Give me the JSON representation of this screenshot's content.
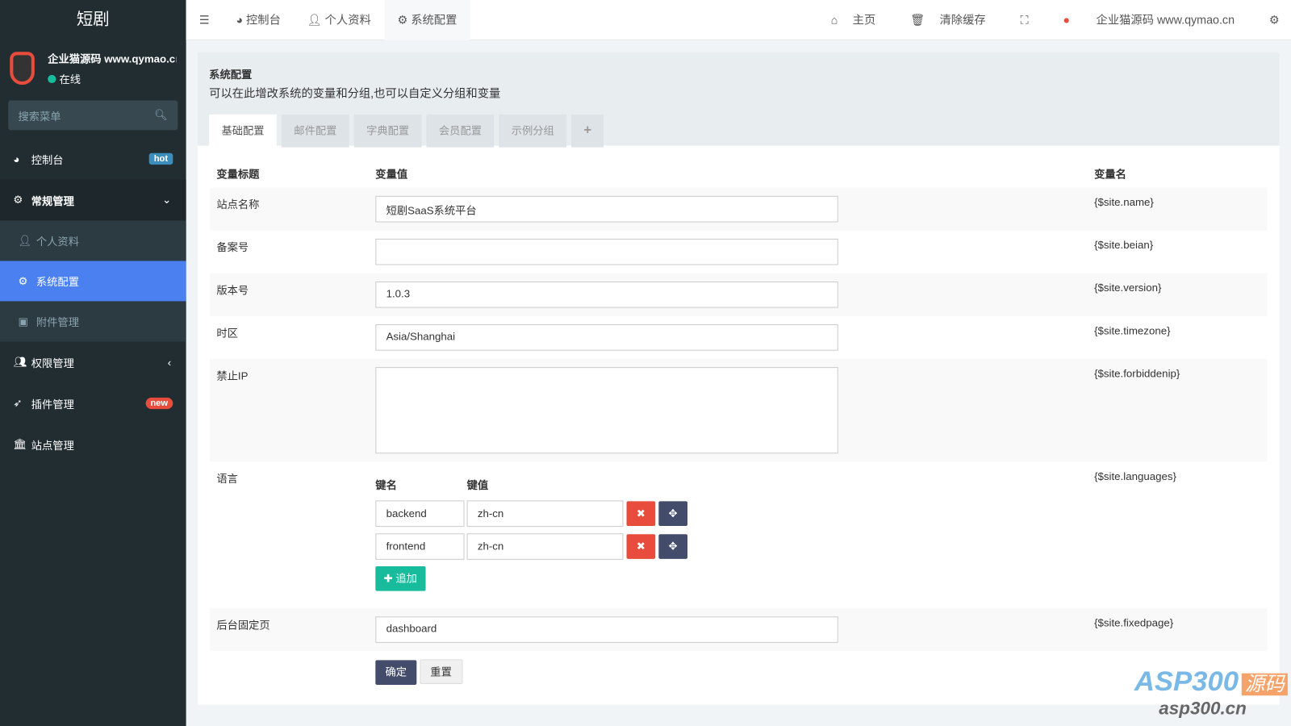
{
  "sidebar": {
    "logo": "短剧",
    "user_name": "企业猫源码 www.qymao.cn",
    "status": "在线",
    "search_placeholder": "搜索菜单",
    "items": [
      {
        "label": "控制台",
        "badge": "hot"
      },
      {
        "label": "常规管理"
      },
      {
        "label": "个人资料"
      },
      {
        "label": "系统配置"
      },
      {
        "label": "附件管理"
      },
      {
        "label": "权限管理"
      },
      {
        "label": "插件管理",
        "badge": "new"
      },
      {
        "label": "站点管理"
      }
    ]
  },
  "topbar": {
    "tabs": [
      "控制台",
      "个人资料",
      "系统配置"
    ],
    "home": "主页",
    "clear_cache": "清除缓存",
    "user": "企业猫源码 www.qymao.cn"
  },
  "panel": {
    "title": "系统配置",
    "desc": "可以在此增改系统的变量和分组,也可以自定义分组和变量",
    "tabs": [
      "基础配置",
      "邮件配置",
      "字典配置",
      "会员配置",
      "示例分组",
      "+"
    ],
    "headers": [
      "变量标题",
      "变量值",
      "变量名"
    ],
    "rows": [
      {
        "title": "站点名称",
        "value": "短剧SaaS系统平台",
        "name": "{$site.name}"
      },
      {
        "title": "备案号",
        "value": "",
        "name": "{$site.beian}"
      },
      {
        "title": "版本号",
        "value": "1.0.3",
        "name": "{$site.version}"
      },
      {
        "title": "时区",
        "value": "Asia/Shanghai",
        "name": "{$site.timezone}"
      },
      {
        "title": "禁止IP",
        "value": "",
        "name": "{$site.forbiddenip}"
      },
      {
        "title": "语言",
        "name": "{$site.languages}",
        "key_label": "键名",
        "val_label": "键值",
        "pairs": [
          {
            "k": "backend",
            "v": "zh-cn"
          },
          {
            "k": "frontend",
            "v": "zh-cn"
          }
        ],
        "add": "追加"
      },
      {
        "title": "后台固定页",
        "value": "dashboard",
        "name": "{$site.fixedpage}"
      }
    ],
    "submit": "确定",
    "reset": "重置"
  },
  "watermark": {
    "brand": "ASP300",
    "tag": "源码",
    "url": "asp300.cn"
  }
}
